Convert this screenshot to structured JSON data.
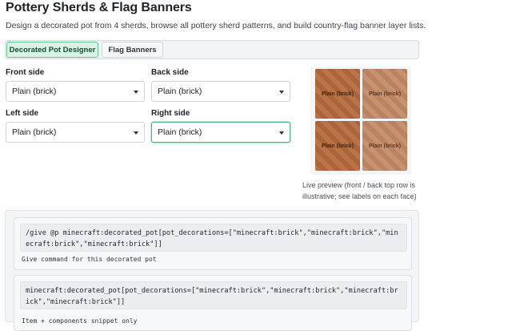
{
  "header": {
    "title": "Pottery Sherds & Flag Banners",
    "description": "Design a decorated pot from 4 sherds, browse all pottery sherd patterns, and build country-flag banner layer lists."
  },
  "tabs": [
    {
      "label": "Decorated Pot Designer",
      "active": true
    },
    {
      "label": "Flag Banners",
      "active": false
    }
  ],
  "designer": {
    "front": {
      "label": "Front side",
      "value": "Plain (brick)"
    },
    "back": {
      "label": "Back side",
      "value": "Plain (brick)"
    },
    "left": {
      "label": "Left side",
      "value": "Plain (brick)"
    },
    "right": {
      "label": "Right side",
      "value": "Plain (brick)"
    }
  },
  "preview": {
    "faces": [
      "Plain (brick)",
      "Plain (brick)",
      "Plain (brick)",
      "Plain (brick)"
    ],
    "caption": "Live preview (front / back top row is illustrative; see labels on each face)"
  },
  "outputs": {
    "give_command": "/give @p minecraft:decorated_pot[pot_decorations=[\"minecraft:brick\",\"minecraft:brick\",\"minecraft:brick\",\"minecraft:brick\"]]",
    "give_caption": "Give command for this decorated pot",
    "snippet": "minecraft:decorated_pot[pot_decorations=[\"minecraft:brick\",\"minecraft:brick\",\"minecraft:brick\",\"minecraft:brick\"]]",
    "snippet_caption": "Item + components snippet only"
  },
  "colors": {
    "accent": "#4cb782",
    "active_tab_bg": "#d9f4e6",
    "brick_light": "#c48a66",
    "brick_dark": "#b5693c"
  }
}
